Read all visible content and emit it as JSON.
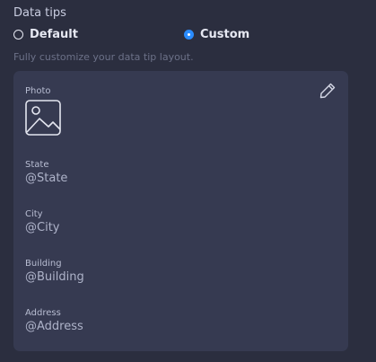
{
  "section": {
    "title": "Data tips"
  },
  "mode": {
    "options": [
      {
        "label": "Default",
        "selected": false
      },
      {
        "label": "Custom",
        "selected": true
      }
    ],
    "helper_text": "Fully customize your data tip layout."
  },
  "card": {
    "photo_label": "Photo",
    "photo_icon": "image-placeholder-icon",
    "edit_icon": "pencil-icon",
    "fields": [
      {
        "label": "State",
        "value": "@State"
      },
      {
        "label": "City",
        "value": "@City"
      },
      {
        "label": "Building",
        "value": "@Building"
      },
      {
        "label": "Address",
        "value": "@Address"
      }
    ]
  },
  "colors": {
    "background": "#2b2e3f",
    "card": "#363a51",
    "accent": "#2a8cff"
  }
}
